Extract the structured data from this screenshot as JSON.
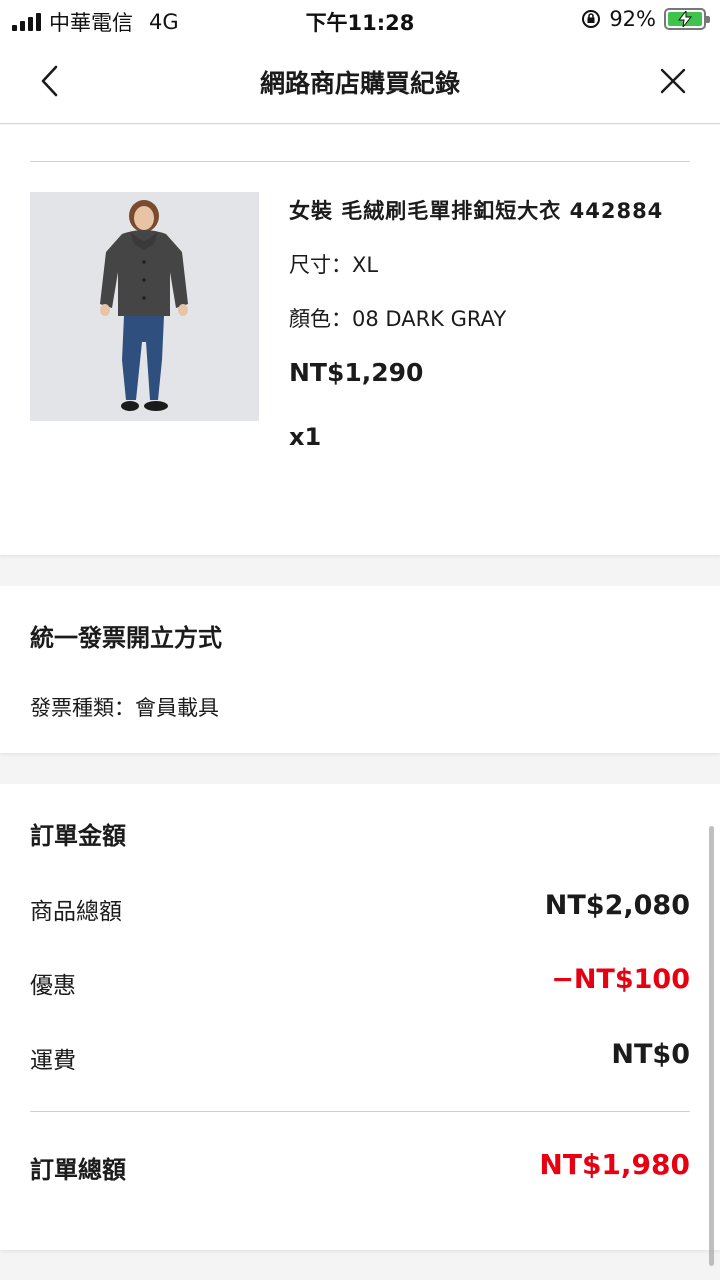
{
  "status_bar": {
    "carrier": "中華電信",
    "network": "4G",
    "time": "下午11:28",
    "battery": "92%"
  },
  "header": {
    "title": "網路商店購買紀錄",
    "back_icon": "chevron-left-icon",
    "close_icon": "close-icon"
  },
  "product": {
    "name": "女裝 毛絨刷毛單排釦短大衣 442884",
    "size": "尺寸：XL",
    "color": "顏色：08 DARK GRAY",
    "price": "NT$1,290",
    "quantity": "x1"
  },
  "invoice": {
    "title": "統一發票開立方式",
    "type": "發票種類：會員載具"
  },
  "order": {
    "title": "訂單金額",
    "subtotal_label": "商品總額",
    "subtotal_value": "NT$2,080",
    "discount_label": "優惠",
    "discount_value": "−NT$100",
    "shipping_label": "運費",
    "shipping_value": "NT$0",
    "total_label": "訂單總額",
    "total_value": "NT$1,980"
  },
  "colors": {
    "accent_red": "#e60012",
    "battery_green": "#3ec44c"
  }
}
